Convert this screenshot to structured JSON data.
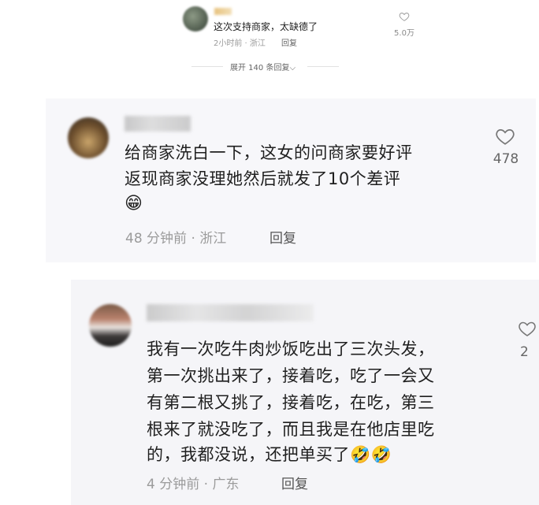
{
  "top_comment": {
    "text": "这次支持商家，太缺德了",
    "time": "2小时前",
    "location": "浙江",
    "reply_label": "回复",
    "like_count": "5.0万",
    "expand_label": "展开 140 条回复"
  },
  "comment_1": {
    "lines": [
      "给商家洗白一下，这女的问商家要好评",
      "返现商家没理她然后就发了10个差评"
    ],
    "emoji": "😁",
    "time": "48 分钟前",
    "location": "浙江",
    "reply_label": "回复",
    "like_count": "478"
  },
  "comment_2": {
    "lines": [
      "我有一次吃牛肉炒饭吃出了三次头发，",
      "第一次挑出来了，接着吃，吃了一会又",
      "有第二根又挑了，接着吃，在吃，第三",
      "根来了就没吃了，而且我是在他店里吃",
      "的，我都没说，还把单买了"
    ],
    "emoji": "🤣🤣",
    "time": "4 分钟前",
    "location": "广东",
    "reply_label": "回复",
    "like_count": "2"
  },
  "colors": {
    "panel_bg": "#f7f7fa",
    "meta_gray": "#9b9b9b"
  },
  "icons": {
    "like": "heart-outline-icon",
    "expand": "chevron-down-icon"
  }
}
